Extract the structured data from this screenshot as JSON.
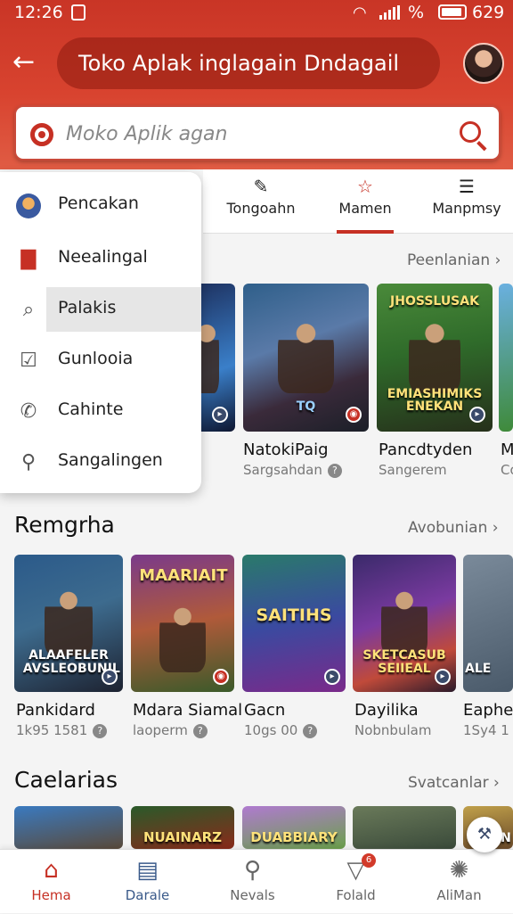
{
  "status": {
    "time": "12:26",
    "wifi": "wifi-icon",
    "percent": "%",
    "battery": "629"
  },
  "header": {
    "title": "Toko Aplak inglagain Dndagail",
    "back_icon": "back-arrow-icon"
  },
  "search": {
    "placeholder": "Moko Aplik agan"
  },
  "tabs": [
    {
      "label": "Tongoahn",
      "icon": "edit-flag-icon",
      "active": false
    },
    {
      "label": "Mamen",
      "icon": "star-icon",
      "active": true
    },
    {
      "label": "Manpmsy",
      "icon": "list-icon",
      "active": false
    }
  ],
  "menu": [
    {
      "label": "Pencakan",
      "icon": "game-avatar-icon"
    },
    {
      "label": "Neealingal",
      "icon": "store-icon"
    },
    {
      "label": "Palakis",
      "icon": "search-doc-icon",
      "selected": true
    },
    {
      "label": "Gunlooia",
      "icon": "edit-icon"
    },
    {
      "label": "Cahinte",
      "icon": "phone-icon"
    },
    {
      "label": "Sangalingen",
      "icon": "search-icon"
    }
  ],
  "section1": {
    "link": "Peenlanian",
    "cards": [
      {
        "title": "n",
        "sub": ""
      },
      {
        "title": "NatokiPaig",
        "sub": "Sargsahdan",
        "art": "TQ"
      },
      {
        "title": "Pancdtyden",
        "sub": "Sangerem",
        "art_top": "JHOSSLUSAK",
        "art": "EMIASHIMIKS ENEKAN"
      },
      {
        "title": "M",
        "sub": "Co"
      }
    ]
  },
  "section2": {
    "title": "Remgrha",
    "link": "Avobunian",
    "cards": [
      {
        "title": "Pankidard",
        "sub": "1k95 1581",
        "art": "ALAAFELER AVSLEOBUNIL"
      },
      {
        "title": "Mdara Siamal",
        "sub": "laoperm",
        "art": "MAARIAIT"
      },
      {
        "title": "Gacn",
        "sub": "10gs  00",
        "art": "SAITIHS"
      },
      {
        "title": "Dayilika",
        "sub": "Nobnbulam",
        "art": "SKETCASUB SEIIEAL"
      },
      {
        "title": "Eaphea",
        "sub": "1Sy4 1",
        "art": "ALE"
      }
    ]
  },
  "section3": {
    "title": "Caelarias",
    "link": "Svatcanlar",
    "cards": [
      {
        "art": ""
      },
      {
        "art": "NUAINARZ"
      },
      {
        "art": "DUABBIARY"
      },
      {
        "art": ""
      },
      {
        "art": "IIEN"
      }
    ]
  },
  "bottomnav": [
    {
      "label": "Hema",
      "icon": "home-icon",
      "active": true
    },
    {
      "label": "Darale",
      "icon": "news-icon"
    },
    {
      "label": "Nevals",
      "icon": "search-icon"
    },
    {
      "label": "Folald",
      "icon": "filter-icon",
      "badge": "6"
    },
    {
      "label": "AliMan",
      "icon": "settings-icon"
    }
  ],
  "colors": {
    "brand": "#c63024",
    "header_top": "#c93526",
    "background": "#f4f4f4"
  }
}
